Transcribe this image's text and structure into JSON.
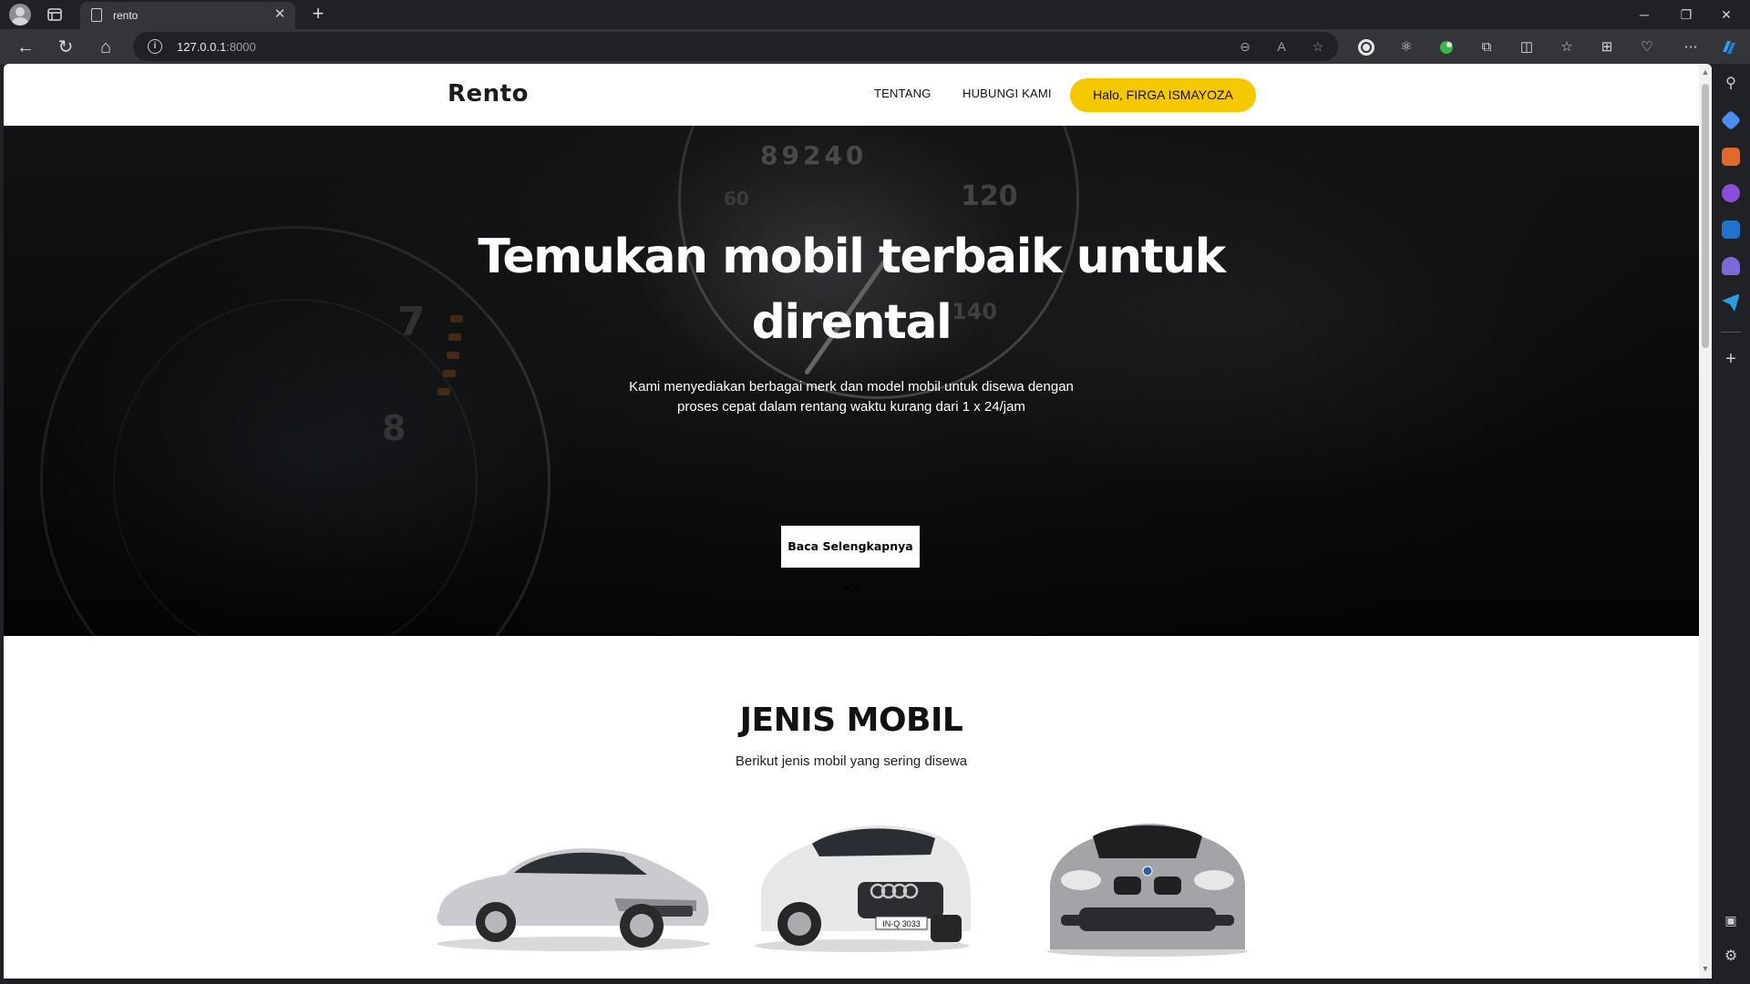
{
  "browser": {
    "tab_title": "rento",
    "url_host": "127.0.0.1",
    "url_port": ":8000"
  },
  "site": {
    "logo": "Rento",
    "nav": {
      "about": "TENTANG",
      "contact": "HUBUNGI KAMI",
      "user_greeting": "Halo, FIRGA ISMAYOZA"
    },
    "hero": {
      "title_line1": "Temukan mobil terbaik untuk",
      "title_line2": "dirental",
      "subtitle_line1": "Kami menyediakan berbagai merk dan model mobil untuk disewa dengan",
      "subtitle_line2": "proses cepat dalam rentang waktu kurang dari 1 x 24/jam",
      "cta": "Baca Selengkapnya >>",
      "gauge_numbers": [
        "7",
        "8",
        "89240",
        "120",
        "60",
        "140"
      ]
    },
    "car_types": {
      "title": "JENIS MOBIL",
      "subtitle": "Berikut jenis mobil yang sering disewa",
      "plate_text": "IN-Q 3033"
    }
  },
  "colors": {
    "accent_yellow": "#f5c800",
    "hero_dark": "#111214",
    "text_dark": "#111111"
  }
}
